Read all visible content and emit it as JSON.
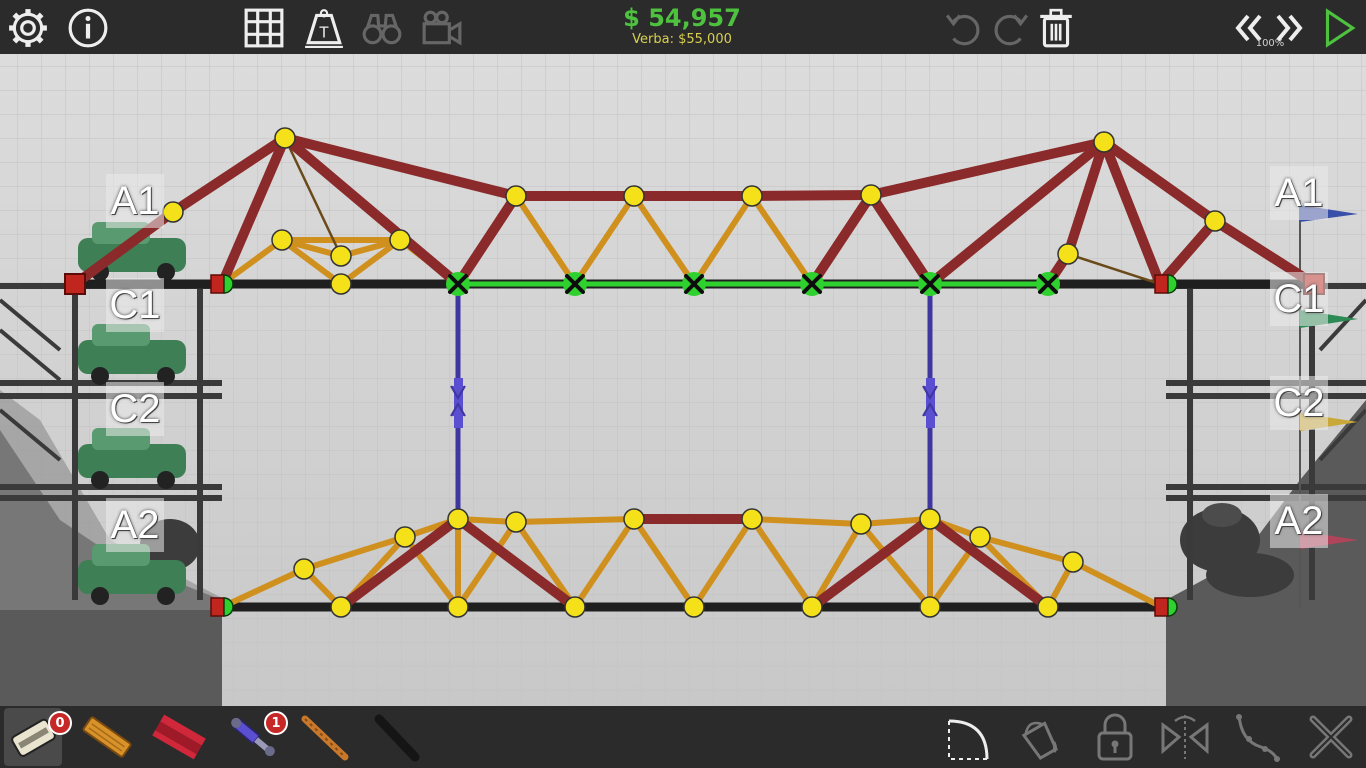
{
  "toolbar": {
    "settings_icon": "gear-icon",
    "info_icon": "info-icon",
    "grid_icon": "grid-icon",
    "weight_icon": "weight-icon",
    "weight_icon_letter": "T",
    "binoculars_icon": "binoculars-icon",
    "camera_icon": "video-camera-icon",
    "undo_icon": "undo-icon",
    "redo_icon": "redo-icon",
    "trash_icon": "trash-icon",
    "rewind_icon": "rewind-icon",
    "fast_forward_icon": "fast-forward-icon",
    "play_icon": "play-icon"
  },
  "budget": {
    "value": "$ 54,957",
    "limit": "Verba: $55,000"
  },
  "simulation": {
    "speed": "100%"
  },
  "lanes": {
    "left": [
      "A1",
      "C1",
      "C2",
      "A2"
    ],
    "right": [
      "A1",
      "C1",
      "C2",
      "A2"
    ]
  },
  "flag_colors": {
    "A1": "#3a4fa8",
    "C1": "#2e8a55",
    "C2": "#c9a83a",
    "A2": "#b0445a"
  },
  "materials": {
    "road": {
      "icon": "road-material-icon",
      "count": "0"
    },
    "wood": {
      "icon": "wood-material-icon"
    },
    "steel": {
      "icon": "steel-material-icon"
    },
    "hydraulic": {
      "icon": "hydraulic-material-icon",
      "count": "1"
    },
    "rope": {
      "icon": "rope-material-icon"
    },
    "cable": {
      "icon": "cable-material-icon"
    }
  },
  "tools": {
    "arc": "arc-tool-icon",
    "paint": "paint-bucket-icon",
    "lock": "lock-icon",
    "mirror": "mirror-icon",
    "spline": "spline-icon",
    "close": "close-icon"
  },
  "colors": {
    "steel": "#8b2a2a",
    "wood": "#d0901e",
    "hydraulic": "#3f36a0",
    "joint": "#f5e11a",
    "selected": "#2fd12f",
    "road": "#1f1f1f",
    "anchor": "#c0261e",
    "budget": "#4ec23f"
  }
}
